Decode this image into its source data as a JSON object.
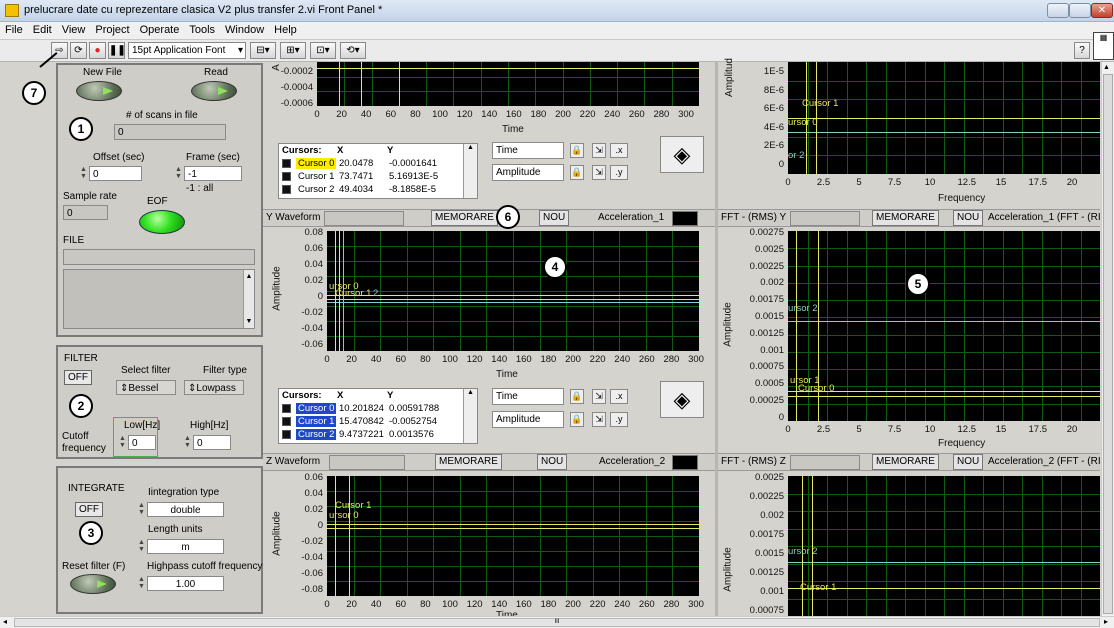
{
  "window": {
    "title": "prelucrare date cu reprezentare clasica V2 plus transfer 2.vi Front Panel *"
  },
  "menu": [
    "File",
    "Edit",
    "View",
    "Project",
    "Operate",
    "Tools",
    "Window",
    "Help"
  ],
  "toolbar": {
    "font": "15pt Application Font",
    "help": "?"
  },
  "markers": {
    "m1": "1",
    "m2": "2",
    "m3": "3",
    "m4": "4",
    "m5": "5",
    "m6": "6",
    "m7": "7"
  },
  "file_panel": {
    "new_file": "New File",
    "read": "Read",
    "scans_label": "# of scans in file",
    "scans_value": "0",
    "offset_label": "Offset (sec)",
    "offset_value": "0",
    "frame_label": "Frame (sec)",
    "frame_value": "-1",
    "frame_hint": "-1 : all",
    "sample_rate_label": "Sample rate",
    "sample_rate_value": "0",
    "eof": "EOF",
    "file_label": "FILE"
  },
  "filter_panel": {
    "title": "FILTER",
    "off": "OFF",
    "select_filter_label": "Select filter",
    "select_filter_value": "Bessel",
    "filter_type_label": "Filter type",
    "filter_type_value": "Lowpass",
    "cutoff": "Cutoff",
    "frequency": "frequency",
    "low_label": "Low[Hz]",
    "low_value": "0",
    "high_label": "High[Hz]",
    "high_value": "0"
  },
  "integrate_panel": {
    "title": "INTEGRATE",
    "off": "OFF",
    "integration_type_label": "Iintegration type",
    "integration_type_value": "double",
    "length_units_label": "Length units",
    "length_units_value": "m",
    "reset_filter": "Reset filter (F)",
    "highpass_label": "Highpass cutoff frequency",
    "highpass_value": "1.00"
  },
  "x_graph": {
    "y_axis": "A",
    "y_ticks": [
      "-0.0002",
      "-0.0004",
      "-0.0006"
    ],
    "x_ticks": [
      "0",
      "20",
      "40",
      "60",
      "80",
      "100",
      "120",
      "140",
      "160",
      "180",
      "200",
      "220",
      "240",
      "260",
      "280",
      "300"
    ],
    "x_label": "Time",
    "cursors": {
      "header": [
        "Cursors:",
        "X",
        "Y"
      ],
      "rows": [
        [
          "Cursor 0",
          "20.0478",
          "-0.0001641"
        ],
        [
          "Cursor 1",
          "73.7471",
          "5.16913E-5"
        ],
        [
          "Cursor 2",
          "49.4034",
          "-8.1858E-5"
        ]
      ]
    },
    "time_box": "Time",
    "amp_box": "Amplitude"
  },
  "y_graph": {
    "header": "Y Waveform",
    "memorare": "MEMORARE",
    "nou": "NOU",
    "legend": "Acceleration_1",
    "y_ticks": [
      "0.08",
      "0.06",
      "0.04",
      "0.02",
      "0",
      "-0.02",
      "-0.04",
      "-0.06"
    ],
    "y_label": "Amplitude",
    "x_ticks": [
      "0",
      "20",
      "40",
      "60",
      "80",
      "100",
      "120",
      "140",
      "160",
      "180",
      "200",
      "220",
      "240",
      "260",
      "280",
      "300"
    ],
    "x_label": "Time",
    "cursor_labels": [
      "ursor 0",
      "Cursor 1",
      "2"
    ],
    "cursors": {
      "header": [
        "Cursors:",
        "X",
        "Y"
      ],
      "rows": [
        [
          "Cursor 0",
          "10.201824",
          "0.00591788"
        ],
        [
          "Cursor 1",
          "15.470842",
          "-0.0052754"
        ],
        [
          "Cursor 2",
          "9.4737221",
          "0.0013576"
        ]
      ]
    },
    "time_box": "Time",
    "amp_box": "Amplitude"
  },
  "z_graph": {
    "header": "Z Waveform",
    "memorare": "MEMORARE",
    "nou": "NOU",
    "legend": "Acceleration_2",
    "y_ticks": [
      "0.06",
      "0.04",
      "0.02",
      "0",
      "-0.02",
      "-0.04",
      "-0.06",
      "-0.08"
    ],
    "y_label": "Amplitude",
    "x_ticks": [
      "0",
      "20",
      "40",
      "60",
      "80",
      "100",
      "120",
      "140",
      "160",
      "180",
      "200",
      "220",
      "240",
      "260",
      "280",
      "300"
    ],
    "x_label": "Time",
    "cursor_labels": [
      "Cursor 1",
      "ursor 0"
    ]
  },
  "fft_x": {
    "y_ticks": [
      "1E-5",
      "8E-6",
      "6E-6",
      "4E-6",
      "2E-6",
      "0"
    ],
    "y_label": "Amplitud",
    "x_ticks": [
      "0",
      "2.5",
      "5",
      "7.5",
      "10",
      "12.5",
      "15",
      "17.5",
      "20"
    ],
    "x_label": "Frequency",
    "cursor_labels": [
      "Cursor 1",
      "ursor 0",
      "or 2"
    ]
  },
  "fft_y": {
    "header": "FFT - (RMS) Y",
    "memorare": "MEMORARE",
    "nou": "NOU",
    "legend": "Acceleration_1 (FFT - (RI",
    "y_ticks": [
      "0.00275",
      "0.0025",
      "0.00225",
      "0.002",
      "0.00175",
      "0.0015",
      "0.00125",
      "0.001",
      "0.00075",
      "0.0005",
      "0.00025",
      "0"
    ],
    "y_label": "Amplitude",
    "x_ticks": [
      "0",
      "2.5",
      "5",
      "7.5",
      "10",
      "12.5",
      "15",
      "17.5",
      "20"
    ],
    "x_label": "Frequency",
    "cursor_labels": [
      "ursor 2",
      "ursor 1",
      "Cursor 0"
    ]
  },
  "fft_z": {
    "header": "FFT - (RMS) Z",
    "memorare": "MEMORARE",
    "nou": "NOU",
    "legend": "Acceleration_2 (FFT - (RI",
    "y_ticks": [
      "0.0025",
      "0.00225",
      "0.002",
      "0.00175",
      "0.0015",
      "0.00125",
      "0.001",
      "0.00075"
    ],
    "y_label": "Amplitude",
    "cursor_labels": [
      "ursor 2",
      "Cursor 1"
    ]
  },
  "scrollbar": {
    "mark": "III"
  }
}
